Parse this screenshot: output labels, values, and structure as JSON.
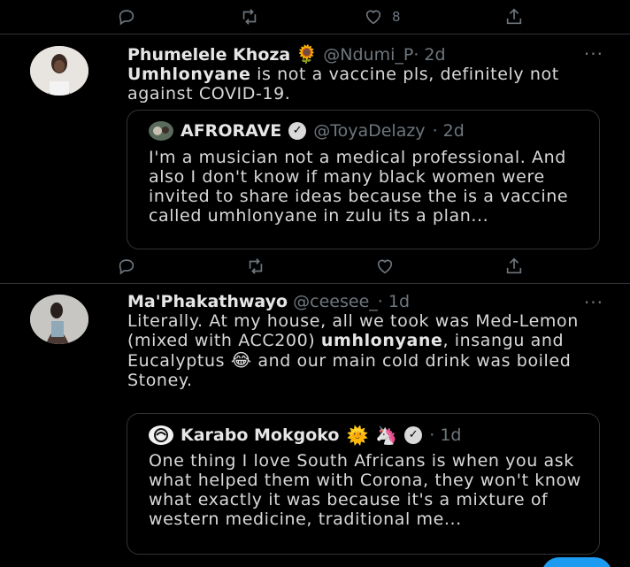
{
  "top_actions": {
    "like_count": "8"
  },
  "tweets": [
    {
      "name": "Phumelele Khoza",
      "name_emoji": "🌻",
      "handle": "@Ndumi_P",
      "time": "· 2d",
      "more": "···",
      "text_bold": "Umhlonyane",
      "text_rest": " is not a vaccine pls, definitely not against COVID-19.",
      "quote": {
        "name": "AFRORAVE",
        "badge": "✓",
        "handle": "@ToyaDelazy",
        "time": "· 2d",
        "text": "I'm a musician not a medical professional. And also I don't know if many black women were invited to share ideas because the is a vaccine called umhlonyane in zulu its a plan..."
      }
    },
    {
      "name": "Ma'Phakathwayo",
      "handle": "@ceesee_",
      "time": "· 1d",
      "more": "···",
      "text_part1": "Literally. At my house, all we took was Med-Lemon (mixed with ACC200) ",
      "text_bold": "umhlonyane",
      "text_part2": ", insangu and Eucalyptus ",
      "text_emoji": "😂",
      "text_part3": " and our main cold drink was boiled Stoney.",
      "quote": {
        "name": "Karabo Mokgoko",
        "emoji1": "🌞",
        "emoji2": "🦄",
        "badge": "✓",
        "time": "· 1d",
        "text": "One thing I love South Africans is when you ask what helped them with Corona, they won't know what exactly it was because it's a mixture of western medicine, traditional me..."
      }
    }
  ]
}
